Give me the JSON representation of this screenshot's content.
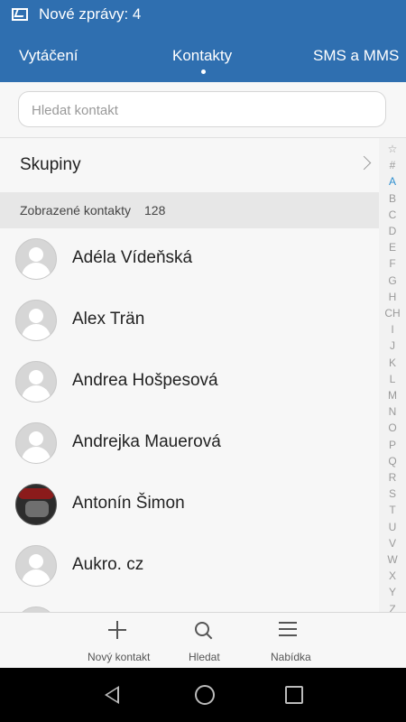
{
  "status": {
    "message": "Nové zprávy: 4"
  },
  "tabs": [
    "Vytáčení",
    "Kontakty",
    "SMS a MMS"
  ],
  "search": {
    "placeholder": "Hledat kontakt",
    "value": ""
  },
  "groups": {
    "label": "Skupiny"
  },
  "section": {
    "title": "Zobrazené kontakty",
    "count": "128"
  },
  "contacts": [
    {
      "name": "Adéla Vídeňská",
      "avatar": "default"
    },
    {
      "name": "Alex Trän",
      "avatar": "default"
    },
    {
      "name": "Andrea Hošpesová",
      "avatar": "default"
    },
    {
      "name": "Andrejka Mauerová",
      "avatar": "default"
    },
    {
      "name": "Antonín Šimon",
      "avatar": "photo"
    },
    {
      "name": "Aukro. cz",
      "avatar": "default"
    },
    {
      "name": "",
      "avatar": "default"
    }
  ],
  "alphabet": [
    "☆",
    "#",
    "A",
    "B",
    "C",
    "D",
    "E",
    "F",
    "G",
    "H",
    "CH",
    "I",
    "J",
    "K",
    "L",
    "M",
    "N",
    "O",
    "P",
    "Q",
    "R",
    "S",
    "T",
    "U",
    "V",
    "W",
    "X",
    "Y",
    "Z"
  ],
  "alphabet_selected": "A",
  "bottom": {
    "new_contact": "Nový kontakt",
    "search": "Hledat",
    "menu": "Nabídka"
  },
  "colors": {
    "accent": "#2f6fb0",
    "selected_letter": "#2f8fcf"
  }
}
